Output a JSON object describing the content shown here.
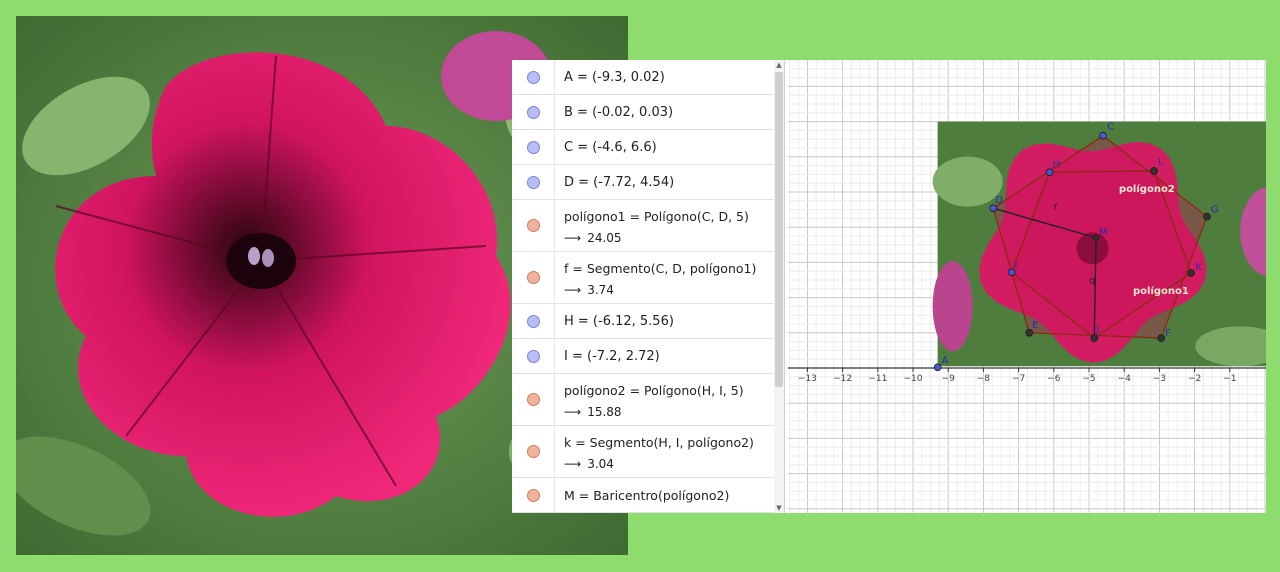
{
  "algebra_view": {
    "rows": [
      {
        "marker": "blue",
        "def": "A = (-9.3, 0.02)"
      },
      {
        "marker": "blue",
        "def": "B = (-0.02, 0.03)"
      },
      {
        "marker": "blue",
        "def": "C = (-4.6, 6.6)"
      },
      {
        "marker": "blue",
        "def": "D = (-7.72, 4.54)"
      },
      {
        "marker": "red",
        "def": "polígono1 = Polígono(C, D, 5)",
        "value": "24.05"
      },
      {
        "marker": "red",
        "def": "f = Segmento(C, D, polígono1)",
        "value": "3.74"
      },
      {
        "marker": "blue",
        "def": "H = (-6.12, 5.56)"
      },
      {
        "marker": "blue",
        "def": "I = (-7.2, 2.72)"
      },
      {
        "marker": "red",
        "def": "polígono2 = Polígono(H, I, 5)",
        "value": "15.88"
      },
      {
        "marker": "red",
        "def": "k = Segmento(H, I, polígono2)",
        "value": "3.04"
      },
      {
        "marker": "red",
        "def": "M = Baricentro(polígono2)"
      }
    ],
    "arrow": "⟶"
  },
  "graphics_view": {
    "x_ticks": [
      "−13",
      "−12",
      "−11",
      "−10",
      "−9",
      "−8",
      "−7",
      "−6",
      "−5",
      "−4",
      "−3",
      "−2",
      "−1"
    ],
    "point_labels": [
      "A",
      "C",
      "D",
      "G",
      "L",
      "H",
      "K",
      "F",
      "J",
      "E",
      "I",
      "M"
    ],
    "segment_labels": [
      "r",
      "q"
    ],
    "polygon_labels": [
      "polígono2",
      "polígono1"
    ],
    "colors": {
      "point_blue": "#4a55d0",
      "polygon_fill": "#c8145a",
      "polygon_edge": "#8b2a10",
      "background": "#8fdc6e"
    }
  }
}
